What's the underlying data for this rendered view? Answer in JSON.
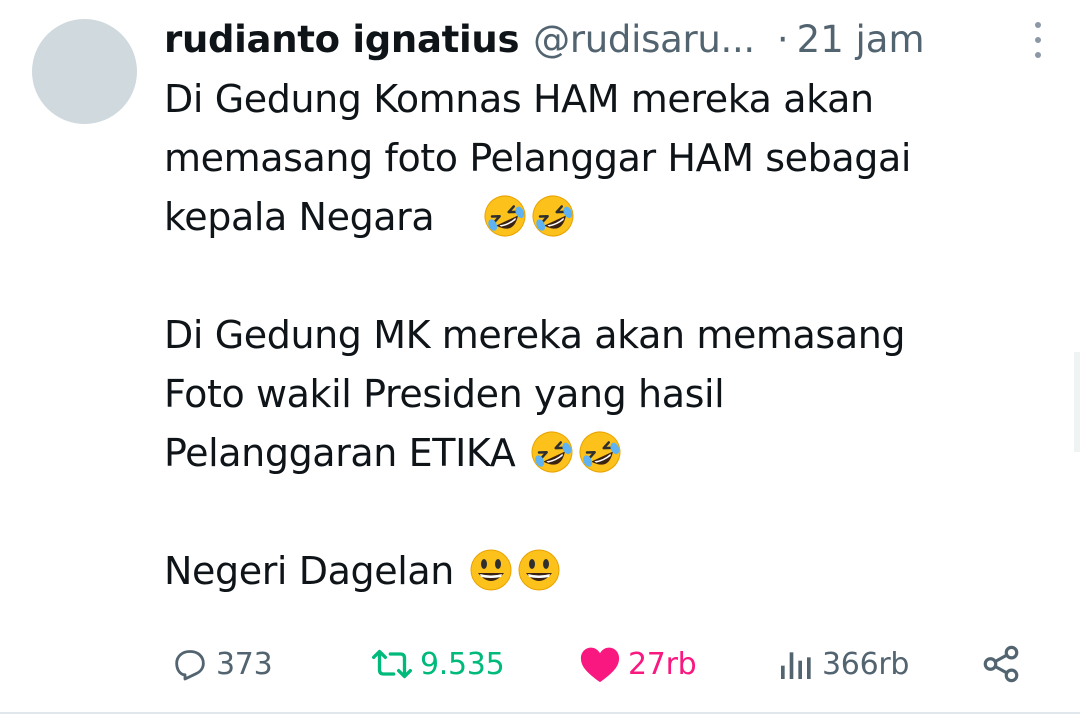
{
  "tweet": {
    "display_name": "rudianto ignatius",
    "handle": "@rudisaru...",
    "separator": "·",
    "time": "21 jam",
    "lines": [
      "Di Gedung Komnas HAM mereka akan",
      "memasang foto Pelanggar HAM sebagai",
      "kepala Negara",
      "Di Gedung MK mereka akan memasang",
      "Foto wakil Presiden yang hasil",
      "Pelanggaran ETIKA",
      "Negeri Dagelan"
    ],
    "emojis": {
      "line3": [
        "rolling-on-floor-laughing-emoji",
        "rolling-on-floor-laughing-emoji"
      ],
      "line6": [
        "rolling-on-floor-laughing-emoji",
        "rolling-on-floor-laughing-emoji"
      ],
      "line7": [
        "grinning-face-emoji",
        "grinning-face-emoji"
      ]
    }
  },
  "actions": {
    "reply": {
      "icon": "reply-icon",
      "count": "373"
    },
    "retweet": {
      "icon": "retweet-icon",
      "count": "9.535",
      "color": "#00ba7c"
    },
    "like": {
      "icon": "heart-icon",
      "count": "27rb",
      "color": "#f91880"
    },
    "views": {
      "icon": "views-icon",
      "count": "366rb"
    },
    "share": {
      "icon": "share-icon"
    }
  },
  "colors": {
    "text": "#0f1419",
    "secondary": "#536471",
    "avatar_placeholder": "#cfd9de"
  }
}
